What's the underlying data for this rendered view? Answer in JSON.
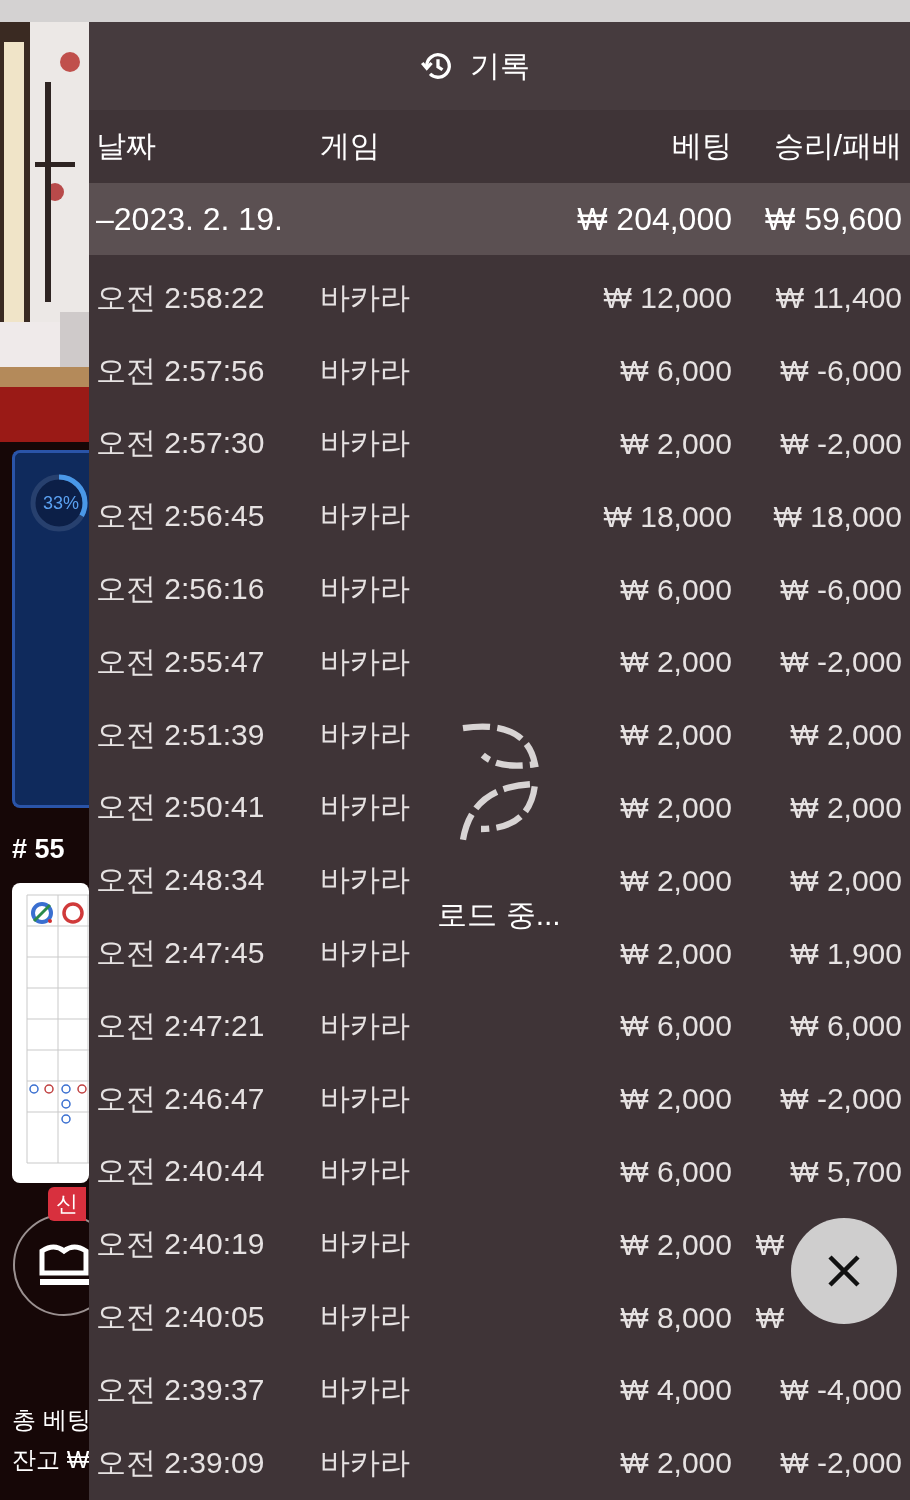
{
  "background": {
    "progress": {
      "label": "33%"
    },
    "round": "# 55",
    "badge": "신",
    "total_bet": "총 베팅",
    "balance": "잔고 ₩"
  },
  "title": "기록",
  "columns": [
    "날짜",
    "게임",
    "베팅",
    "승리/패배"
  ],
  "group": {
    "date": "–2023. 2. 19.",
    "bet": "₩ 204,000",
    "result": "₩ 59,600"
  },
  "rows": [
    {
      "time": "오전 2:58:22",
      "game": "바카라",
      "bet": "₩ 12,000",
      "result": "₩ 11,400"
    },
    {
      "time": "오전 2:57:56",
      "game": "바카라",
      "bet": "₩ 6,000",
      "result": "₩ -6,000"
    },
    {
      "time": "오전 2:57:30",
      "game": "바카라",
      "bet": "₩ 2,000",
      "result": "₩ -2,000"
    },
    {
      "time": "오전 2:56:45",
      "game": "바카라",
      "bet": "₩ 18,000",
      "result": "₩ 18,000"
    },
    {
      "time": "오전 2:56:16",
      "game": "바카라",
      "bet": "₩ 6,000",
      "result": "₩ -6,000"
    },
    {
      "time": "오전 2:55:47",
      "game": "바카라",
      "bet": "₩ 2,000",
      "result": "₩ -2,000"
    },
    {
      "time": "오전 2:51:39",
      "game": "바카라",
      "bet": "₩ 2,000",
      "result": "₩ 2,000"
    },
    {
      "time": "오전 2:50:41",
      "game": "바카라",
      "bet": "₩ 2,000",
      "result": "₩ 2,000"
    },
    {
      "time": "오전 2:48:34",
      "game": "바카라",
      "bet": "₩ 2,000",
      "result": "₩ 2,000"
    },
    {
      "time": "오전 2:47:45",
      "game": "바카라",
      "bet": "₩ 2,000",
      "result": "₩ 1,900"
    },
    {
      "time": "오전 2:47:21",
      "game": "바카라",
      "bet": "₩ 6,000",
      "result": "₩ 6,000"
    },
    {
      "time": "오전 2:46:47",
      "game": "바카라",
      "bet": "₩ 2,000",
      "result": "₩ -2,000"
    },
    {
      "time": "오전 2:40:44",
      "game": "바카라",
      "bet": "₩ 6,000",
      "result": "₩ 5,700"
    },
    {
      "time": "오전 2:40:19",
      "game": "바카라",
      "bet": "₩ 2,000",
      "result": "₩"
    },
    {
      "time": "오전 2:40:05",
      "game": "바카라",
      "bet": "₩ 8,000",
      "result": "₩"
    },
    {
      "time": "오전 2:39:37",
      "game": "바카라",
      "bet": "₩ 4,000",
      "result": "₩ -4,000"
    },
    {
      "time": "오전 2:39:09",
      "game": "바카라",
      "bet": "₩ 2,000",
      "result": "₩ -2,000"
    }
  ],
  "loading": {
    "label": "로드 중..."
  }
}
